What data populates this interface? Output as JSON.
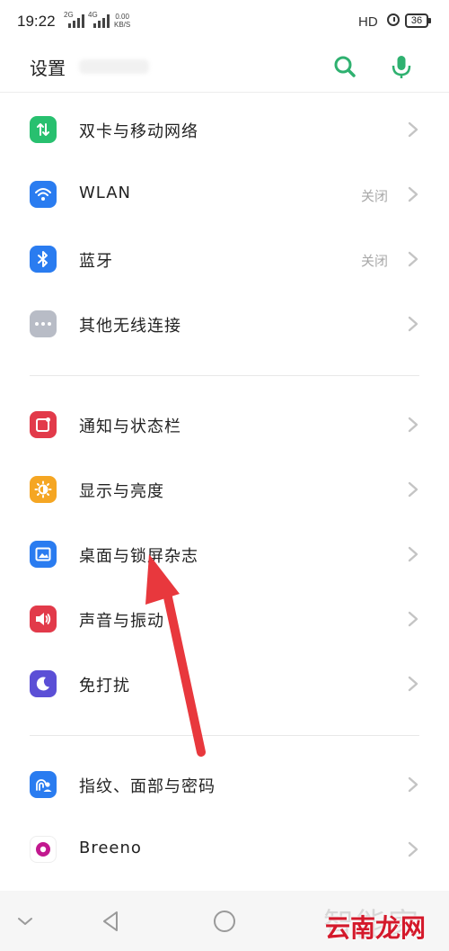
{
  "status_bar": {
    "time": "19:22",
    "net1": "2G",
    "net2": "4G",
    "speed_value": "0.00",
    "speed_unit": "KB/S",
    "hd": "HD",
    "battery": "36"
  },
  "header": {
    "title": "设置",
    "search_icon": "search-icon",
    "mic_icon": "microphone-icon",
    "accent_color": "#2fb170"
  },
  "sections": [
    {
      "items": [
        {
          "label": "双卡与移动网络",
          "value": "",
          "icon": "sim-network-icon",
          "color": "#28c06f"
        },
        {
          "label": "WLAN",
          "value": "关闭",
          "icon": "wifi-icon",
          "color": "#2a7cf0"
        },
        {
          "label": "蓝牙",
          "value": "关闭",
          "icon": "bluetooth-icon",
          "color": "#2a7cf0"
        },
        {
          "label": "其他无线连接",
          "value": "",
          "icon": "more-dots-icon",
          "color": "#b8bcc6"
        }
      ]
    },
    {
      "items": [
        {
          "label": "通知与状态栏",
          "value": "",
          "icon": "notification-icon",
          "color": "#e23a4a"
        },
        {
          "label": "显示与亮度",
          "value": "",
          "icon": "brightness-icon",
          "color": "#f5a623"
        },
        {
          "label": "桌面与锁屏杂志",
          "value": "",
          "icon": "wallpaper-icon",
          "color": "#2a7cf0"
        },
        {
          "label": "声音与振动",
          "value": "",
          "icon": "volume-icon",
          "color": "#e23a4a"
        },
        {
          "label": "免打扰",
          "value": "",
          "icon": "moon-icon",
          "color": "#5b4fd6"
        }
      ]
    },
    {
      "items": [
        {
          "label": "指纹、面部与密码",
          "value": "",
          "icon": "fingerprint-face-icon",
          "color": "#2a7cf0"
        },
        {
          "label": "Breeno",
          "value": "",
          "icon": "breeno-icon",
          "color": "#ffffff"
        }
      ]
    }
  ],
  "watermark": {
    "top": "智能家",
    "bottom": "云南龙网"
  }
}
